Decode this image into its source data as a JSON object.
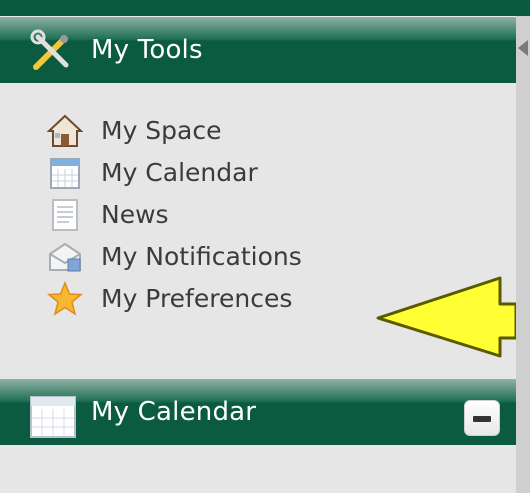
{
  "tools_panel": {
    "title": "My Tools",
    "items": [
      {
        "label": "My Space",
        "icon": "house-icon"
      },
      {
        "label": "My Calendar",
        "icon": "calendar-icon"
      },
      {
        "label": "News",
        "icon": "news-icon"
      },
      {
        "label": "My Notifications",
        "icon": "notifications-icon"
      },
      {
        "label": "My Preferences",
        "icon": "star-icon"
      }
    ]
  },
  "calendar_panel": {
    "title": "My Calendar",
    "header_icon": "calendar-icon",
    "collapse_button_icon": "minus-icon"
  },
  "annotation": {
    "icon": "yellow-arrow-icon"
  },
  "colors": {
    "header_bg": "#0b5b40",
    "panel_bg": "#e6e6e6",
    "text": "#3b3b3b",
    "arrow": "#ffff33"
  }
}
